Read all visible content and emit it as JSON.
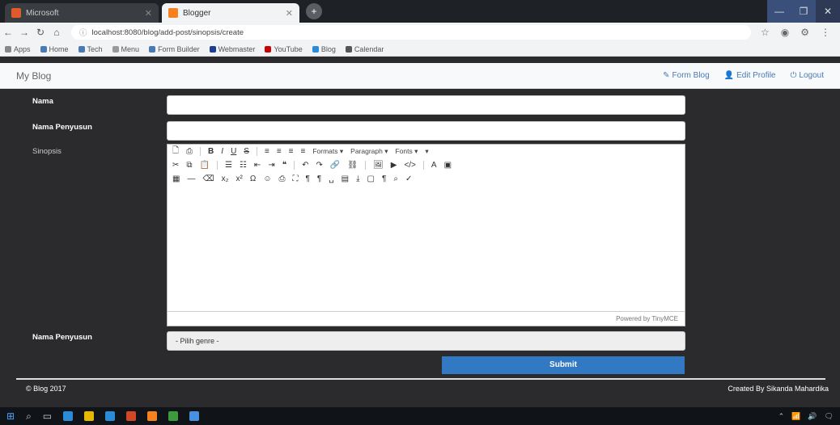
{
  "browser": {
    "tabs": [
      {
        "title": "Microsoft",
        "favicon_color": "#e05a2b"
      },
      {
        "title": "Blogger",
        "favicon_color": "#f5811f"
      }
    ],
    "url": "localhost:8080/blog/add-post/sinopsis/create",
    "bookmarks": [
      "Apps",
      "Home",
      "Tech",
      "Menu",
      "Form Builder",
      "Webmaster",
      "YouTube",
      "Blog",
      "Calendar"
    ],
    "colors": {
      "tab_bar": "#1e2126",
      "chrome": "#f1f3f4"
    }
  },
  "app": {
    "brand": "My Blog",
    "nav": [
      {
        "label": "Form Blog",
        "icon": "pencil-icon"
      },
      {
        "label": "Edit Profile",
        "icon": "user-icon"
      },
      {
        "label": "Logout",
        "icon": "power-icon"
      }
    ]
  },
  "form": {
    "fields": [
      {
        "label": "Nama"
      },
      {
        "label": "Nama Penyusun"
      }
    ],
    "editor": {
      "label": "Sinopsis",
      "dropdowns": [
        "Formats",
        "Paragraph",
        "Fonts"
      ],
      "status_text": "Powered by TinyMCE"
    },
    "genre": {
      "label": "Nama Penyusun",
      "value": "- Pilih genre -"
    },
    "submit_label": "Submit"
  },
  "footer": {
    "left": "© Blog 2017",
    "right": "Created By Sikanda Mahardika"
  },
  "accent_color": "#3279c3"
}
